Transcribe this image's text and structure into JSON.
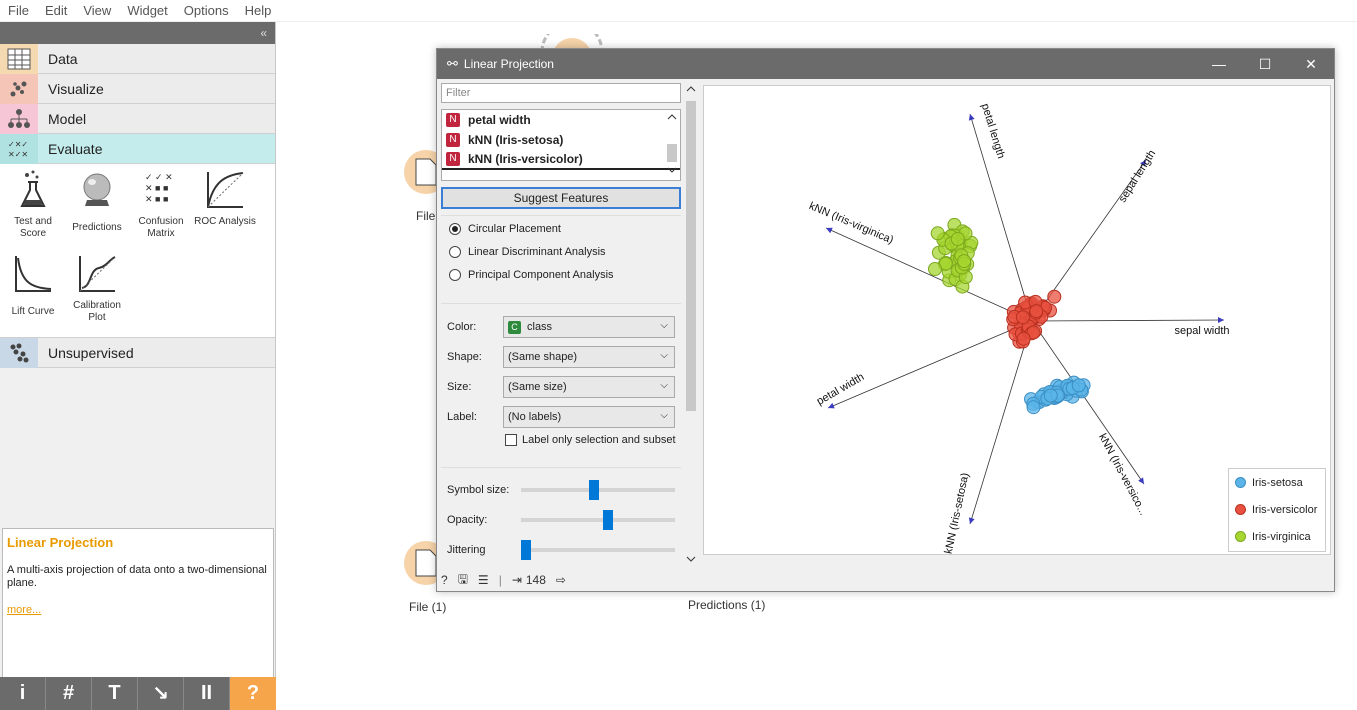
{
  "menubar": {
    "items": [
      "File",
      "Edit",
      "View",
      "Widget",
      "Options",
      "Help"
    ]
  },
  "toolbox": {
    "collapse_glyph": "«",
    "categories": [
      {
        "label": "Data",
        "icon": "table-icon"
      },
      {
        "label": "Visualize",
        "icon": "scatter-icon"
      },
      {
        "label": "Model",
        "icon": "tree-icon"
      },
      {
        "label": "Evaluate",
        "icon": "evaluate-icon"
      },
      {
        "label": "Unsupervised",
        "icon": "clusters-icon"
      }
    ],
    "widgets": [
      {
        "label": "Test and Score",
        "icon": "flask-icon"
      },
      {
        "label": "Predictions",
        "icon": "crystal-ball-icon"
      },
      {
        "label": "Confusion Matrix",
        "icon": "confusion-matrix-icon"
      },
      {
        "label": "ROC Analysis",
        "icon": "roc-curve-icon"
      },
      {
        "label": "Lift Curve",
        "icon": "lift-curve-icon"
      },
      {
        "label": "Calibration Plot",
        "icon": "calibration-icon"
      }
    ]
  },
  "description": {
    "title": "Linear Projection",
    "text": "A multi-axis projection of data onto a two-dimensional plane.",
    "more": "more..."
  },
  "bottom_toolbar": [
    "i",
    "#",
    "T",
    "↘",
    "II",
    "?"
  ],
  "canvas": {
    "nodes": [
      {
        "label": "File"
      },
      {
        "label": "File (1)"
      },
      {
        "label": "Predictions (1)"
      }
    ]
  },
  "window": {
    "title": "Linear Projection",
    "buttons": [
      "—",
      "☐",
      "✕"
    ],
    "filter_placeholder": "Filter",
    "features": [
      {
        "badge": "N",
        "label": "petal width"
      },
      {
        "badge": "N",
        "label": "kNN (Iris-setosa)"
      },
      {
        "badge": "N",
        "label": "kNN (Iris-versicolor)"
      }
    ],
    "suggest_button": "Suggest Features",
    "placements": [
      {
        "label": "Circular Placement",
        "checked": true
      },
      {
        "label": "Linear Discriminant Analysis",
        "checked": false
      },
      {
        "label": "Principal Component Analysis",
        "checked": false
      }
    ],
    "attributes": {
      "color_label": "Color:",
      "color_badge": "C",
      "color_value": "class",
      "shape_label": "Shape:",
      "shape_value": "(Same shape)",
      "size_label": "Size:",
      "size_value": "(Same size)",
      "label_label": "Label:",
      "label_value": "(No labels)",
      "label_only": "Label only selection and subset"
    },
    "sliders": [
      {
        "label": "Symbol size:",
        "value": 0.47
      },
      {
        "label": "Opacity:",
        "value": 0.57
      },
      {
        "label": "Jittering",
        "value": 0.0
      }
    ],
    "status_count": "148",
    "plot": {
      "axes": [
        {
          "label": "petal length"
        },
        {
          "label": "sepal length"
        },
        {
          "label": "kNN (Iris-virginica)"
        },
        {
          "label": "sepal width"
        },
        {
          "label": "petal width"
        },
        {
          "label": "kNN (Iris-setosa)"
        },
        {
          "label": "kNN (Iris-versico..."
        }
      ],
      "legend": [
        {
          "label": "Iris-setosa",
          "color": "#5ab4e8"
        },
        {
          "label": "Iris-versicolor",
          "color": "#e8503f"
        },
        {
          "label": "Iris-virginica",
          "color": "#a6d62f"
        }
      ]
    }
  }
}
